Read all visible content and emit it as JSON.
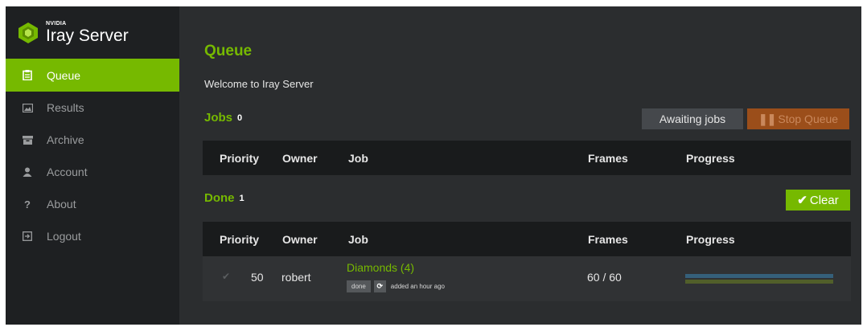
{
  "brand": {
    "vendor": "NVIDIA",
    "product": "Iray Server",
    "accent_color": "#76b900"
  },
  "sidebar": {
    "items": [
      {
        "label": "Queue",
        "icon": "clipboard-icon",
        "active": true
      },
      {
        "label": "Results",
        "icon": "image-icon",
        "active": false
      },
      {
        "label": "Archive",
        "icon": "archive-icon",
        "active": false
      },
      {
        "label": "Account",
        "icon": "user-icon",
        "active": false
      },
      {
        "label": "About",
        "icon": "question-icon",
        "active": false
      },
      {
        "label": "Logout",
        "icon": "logout-icon",
        "active": false
      }
    ]
  },
  "main": {
    "title": "Queue",
    "welcome": "Welcome to Iray Server",
    "jobs": {
      "label": "Jobs",
      "count": "0",
      "awaiting_label": "Awaiting jobs",
      "stop_label": "Stop Queue",
      "stop_icon": "pause-icon",
      "columns": [
        "Priority",
        "Owner",
        "Job",
        "Frames",
        "Progress"
      ]
    },
    "done": {
      "label": "Done",
      "count": "1",
      "clear_label": "Clear",
      "clear_icon": "check-icon",
      "columns": [
        "Priority",
        "Owner",
        "Job",
        "Frames",
        "Progress"
      ],
      "rows": [
        {
          "status_icon": "check-icon",
          "priority": "50",
          "owner": "robert",
          "job": "Diamonds (4)",
          "tag": "done",
          "reload_icon": "reload-icon",
          "added": "added an hour ago",
          "frames": "60 / 60",
          "progress_render": 1.0,
          "progress_frames": 1.0
        }
      ]
    }
  }
}
